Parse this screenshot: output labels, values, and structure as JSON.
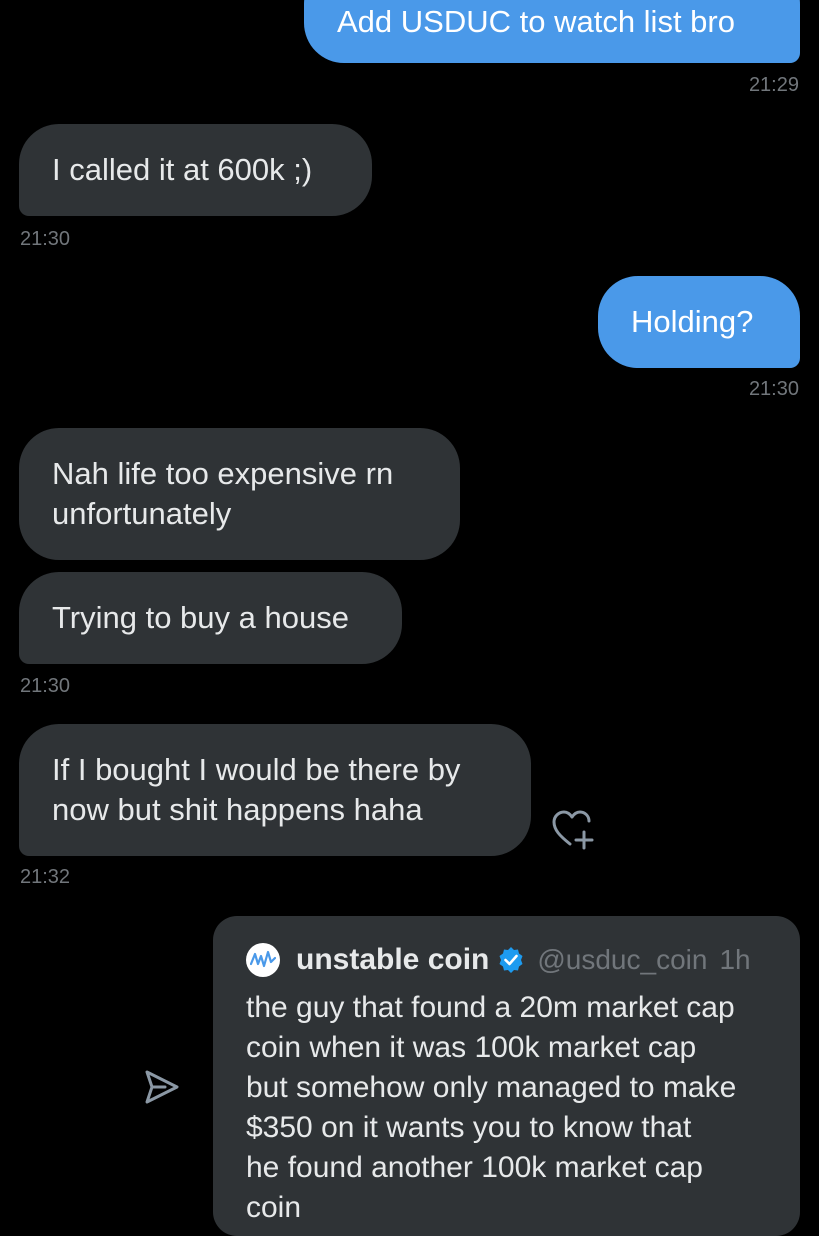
{
  "messages": [
    {
      "text": "Add USDUC to watch list bro",
      "time": "21:29"
    },
    {
      "text": "I called it at 600k ;)",
      "time": "21:30"
    },
    {
      "text": "Holding?",
      "time": "21:30"
    },
    {
      "text": "Nah life too expensive rn\nunfortunately"
    },
    {
      "text": "Trying to buy a house",
      "time": "21:30"
    },
    {
      "text": "If I bought I would be there by\nnow but shit happens haha",
      "time": "21:32"
    }
  ],
  "quoted_post": {
    "author_name": "unstable coin",
    "handle": "@usduc_coin",
    "age": "1h",
    "text": "the guy that found a 20m market cap\ncoin when it was 100k market cap\nbut somehow only managed to make\n$350 on it wants you to know that\nhe found another 100k market cap\ncoin"
  },
  "icons": {
    "react": "heart-plus-icon",
    "share": "send-icon",
    "verified": "verified-badge-icon"
  },
  "colors": {
    "background": "#000000",
    "sent_bubble": "#4a99e9",
    "received_bubble": "#2f3336",
    "timestamp": "#71767b",
    "verified": "#1d9bf0"
  }
}
